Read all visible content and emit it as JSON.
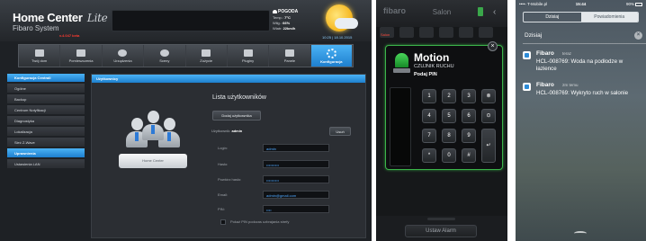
{
  "panel1": {
    "logo_title": "Home Center",
    "logo_lite": "Lite",
    "logo_sub": "Fibaro System",
    "logo_version": "v.4.047 beta",
    "weather": {
      "title": "POGODA",
      "rows": [
        {
          "label": "Temp.:",
          "value": "7°C"
        },
        {
          "label": "Wilg.:",
          "value": "66%"
        },
        {
          "label": "Wiatr:",
          "value": "22km/h"
        }
      ],
      "date": "10:25 | 18.10.2015"
    },
    "nav": [
      {
        "label": "Twój dom"
      },
      {
        "label": "Pomieszczenia"
      },
      {
        "label": "Urządzenia"
      },
      {
        "label": "Sceny"
      },
      {
        "label": "Zużycie"
      },
      {
        "label": "Pluginy"
      },
      {
        "label": "Panele"
      },
      {
        "label": "Konfiguracja"
      }
    ],
    "sidebar": {
      "header": "Konfiguracja Centrali",
      "items": [
        {
          "label": "Ogólne"
        },
        {
          "label": "Backup"
        },
        {
          "label": "Centrum Notyfikacji"
        },
        {
          "label": "Diagnostyka"
        },
        {
          "label": "Lokalizacja"
        },
        {
          "label": "Sieć Z-Wave"
        },
        {
          "label": "Uprawnienia"
        },
        {
          "label": "Ustawienia LAN"
        }
      ]
    },
    "main": {
      "header": "Użytkownicy",
      "list_title": "Lista użytkowników",
      "add_button": "Dodaj użytkownika",
      "user_label": "Użytkownik:",
      "user_name": "admin",
      "delete_button": "Usuń",
      "device_label": "Home Center",
      "fields": [
        {
          "label": "Login:",
          "value": "admin"
        },
        {
          "label": "Hasło:",
          "value": "••••••••••"
        },
        {
          "label": "Powtórz hasło:",
          "value": "••••••••••"
        },
        {
          "label": "Email:",
          "value": "admin@gmail.com"
        },
        {
          "label": "PIN:",
          "value": "••••"
        }
      ],
      "checkbox_label": "Pokaż PIN podczas uzbrajania strefy"
    }
  },
  "panel2": {
    "logo": "fibaro",
    "title": "Salon",
    "small_label": "Salon",
    "card": {
      "title": "Motion",
      "subtitle": "CZUJNIK RUCHU",
      "pin_label": "Podaj PIN",
      "close_icon": "×",
      "keys": [
        "1",
        "2",
        "3",
        "⊗",
        "4",
        "5",
        "6",
        "⊙",
        "7",
        "8",
        "9",
        "↵",
        "*",
        "0",
        "#"
      ]
    },
    "alarm_button": "Ustaw Alarm"
  },
  "panel3": {
    "status": {
      "carrier": "••••◦ T-Mobile.pl",
      "time": "15:44",
      "battery": "90%"
    },
    "segments": [
      {
        "label": "Dzisiaj"
      },
      {
        "label": "Powiadomienia"
      }
    ],
    "section": "Dzisiaj",
    "clear_icon": "×",
    "notifications": [
      {
        "app": "Fibaro",
        "ago": "teraz",
        "message": "HCL-008769: Woda na podłodze w łazience"
      },
      {
        "app": "Fibaro",
        "ago": "2m temu",
        "message": "HCL-008769: Wykryto ruch w salonie"
      }
    ]
  }
}
